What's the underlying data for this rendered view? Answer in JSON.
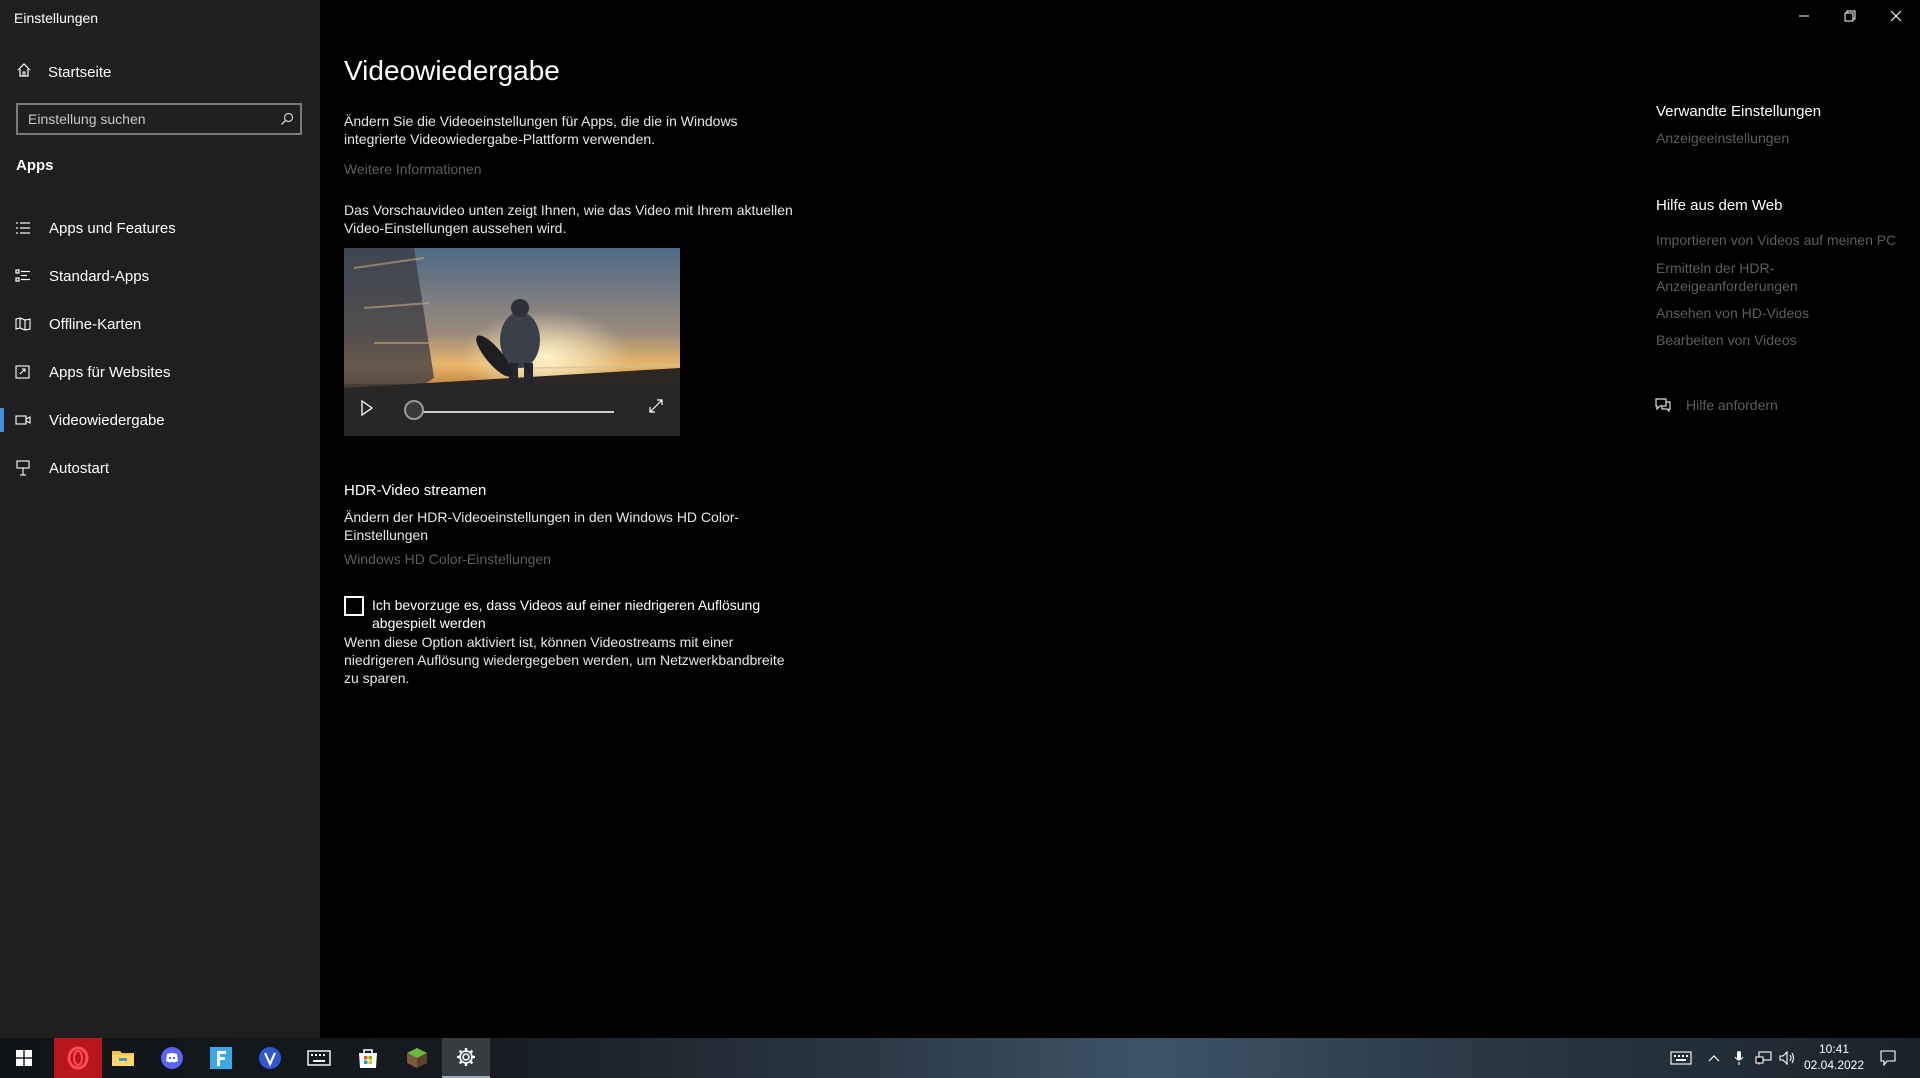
{
  "window": {
    "title": "Einstellungen",
    "minimize": "—",
    "restore": "❐",
    "close": "✕"
  },
  "sidebar": {
    "home_label": "Startseite",
    "search_placeholder": "Einstellung suchen",
    "section_title": "Apps",
    "items": [
      {
        "label": "Apps und Features",
        "icon": "list-icon"
      },
      {
        "label": "Standard-Apps",
        "icon": "default-apps-icon"
      },
      {
        "label": "Offline-Karten",
        "icon": "map-icon"
      },
      {
        "label": "Apps für Websites",
        "icon": "web-apps-icon"
      },
      {
        "label": "Videowiedergabe",
        "icon": "video-icon",
        "active": true
      },
      {
        "label": "Autostart",
        "icon": "startup-icon"
      }
    ]
  },
  "main": {
    "title": "Videowiedergabe",
    "intro_line1": "Ändern Sie die Videoeinstellungen für Apps, die die in Windows",
    "intro_line2": "integrierte Videowiedergabe-Plattform verwenden.",
    "more_info": "Weitere Informationen",
    "preview_line1": "Das Vorschauvideo unten zeigt Ihnen, wie das Video mit Ihrem aktuellen",
    "preview_line2": "Video-Einstellungen aussehen wird.",
    "video": {
      "progress": 0
    },
    "hdr_title": "HDR-Video streamen",
    "hdr_desc_line1": "Ändern der HDR-Videoeinstellungen in den Windows HD Color-",
    "hdr_desc_line2": "Einstellungen",
    "hdr_link": "Windows HD Color-Einstellungen",
    "checkbox_label_line1": "Ich bevorzuge es, dass Videos auf einer niedrigeren Auflösung",
    "checkbox_label_line2": "abgespielt werden",
    "checkbox_checked": false,
    "option_desc_line1": "Wenn diese Option aktiviert ist, können Videostreams mit einer",
    "option_desc_line2": "niedrigeren Auflösung wiedergegeben werden, um Netzwerkbandbreite",
    "option_desc_line3": "zu sparen."
  },
  "related": {
    "title": "Verwandte Einstellungen",
    "link": "Anzeigeeinstellungen",
    "help_title": "Hilfe aus dem Web",
    "help_links": [
      "Importieren von Videos auf meinen PC",
      "Ermitteln der HDR-",
      "Anzeigeanforderungen",
      "Ansehen von HD-Videos",
      "Bearbeiten von Videos"
    ],
    "get_help": "Hilfe anfordern"
  },
  "taskbar": {
    "apps": [
      "windows-start-icon",
      "opera-icon",
      "file-explorer-icon",
      "discord-icon",
      "f-app-icon",
      "v-app-icon",
      "keyboard-app-icon",
      "store-icon",
      "minecraft-icon",
      "settings-icon"
    ],
    "time": "10:41",
    "date": "02.04.2022"
  },
  "colors": {
    "accent": "#4a8fe0",
    "sidebar_bg": "#1f1f1f",
    "main_bg": "#000000",
    "link_dim": "#5d5d5d"
  }
}
